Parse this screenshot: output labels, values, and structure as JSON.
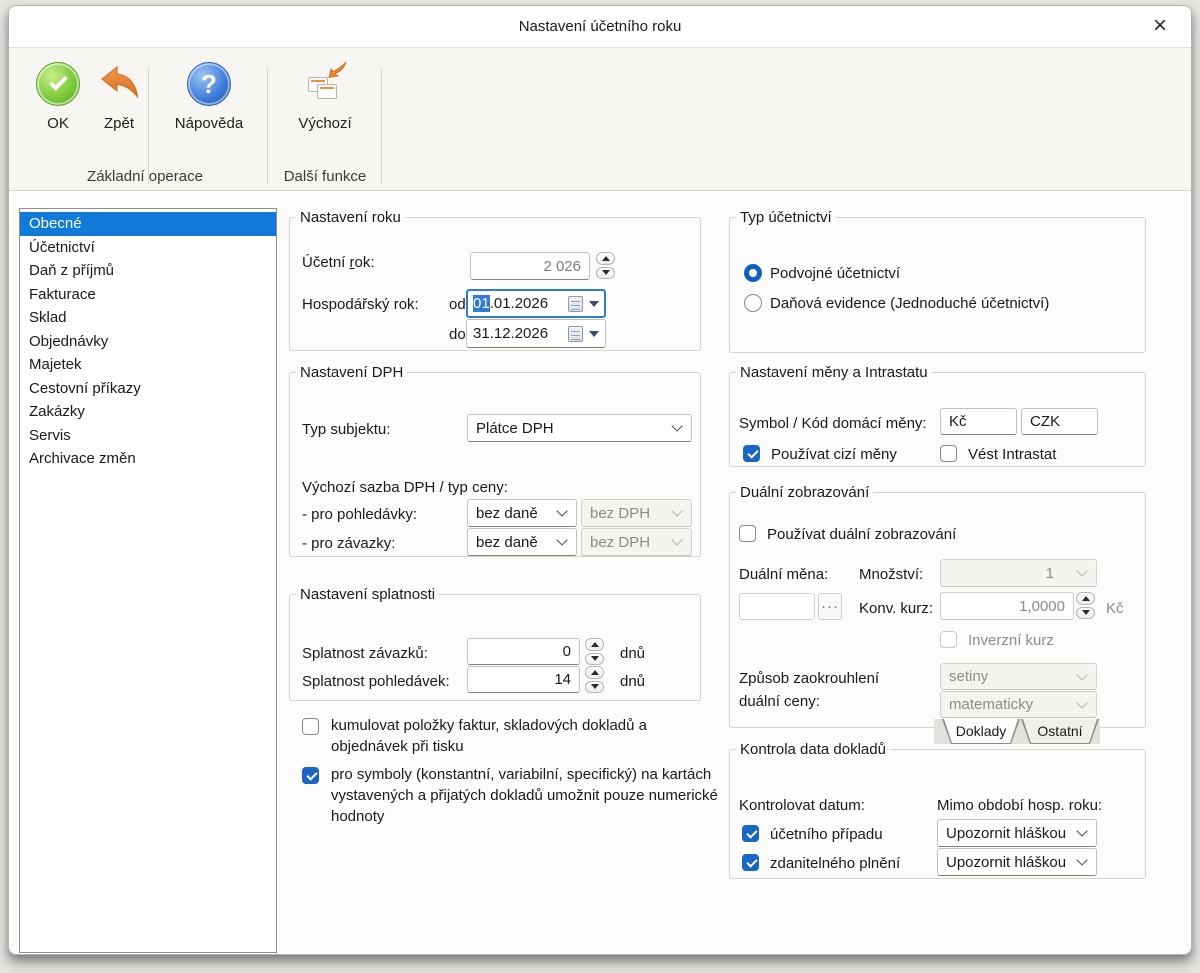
{
  "window": {
    "title": "Nastavení účetního roku",
    "close": "×"
  },
  "colors": {
    "accent": "#0f7ad8",
    "control_blue": "#1a66c4",
    "ok_green": "#6fc32f",
    "undo_orange": "#e0772b"
  },
  "icons": {
    "ok": "green-circle-check",
    "zpet": "orange-undo-arrow",
    "napoveda": "blue-circle-question",
    "vychozi": "windows-with-arrow",
    "date": "calendar-grid"
  },
  "toolbar": {
    "ok": "OK",
    "zpet": "Zpět",
    "napoveda": "Nápověda",
    "vychozi": "Výchozí",
    "group_basic": "Základní operace",
    "group_other": "Další funkce"
  },
  "sidebar": {
    "items": [
      "Obecné",
      "Účetnictví",
      "Daň z příjmů",
      "Fakturace",
      "Sklad",
      "Objednávky",
      "Majetek",
      "Cestovní příkazy",
      "Zakázky",
      "Servis",
      "Archivace změn"
    ],
    "selected": "Obecné"
  },
  "year": {
    "legend": "Nastavení roku",
    "ucetni_pre": "Účetní ",
    "ucetni_key": "r",
    "ucetni_post": "ok:",
    "ucetni_value": "2 026",
    "hosp_label": "Hospodářský rok:",
    "od_label": "od",
    "do_label": "do",
    "od_selected": "01",
    "od_rest": ".01.2026",
    "do_value": "31.12.2026"
  },
  "dph": {
    "legend": "Nastavení DPH",
    "typ_label": "Typ subjektu:",
    "typ_value": "Plátce DPH",
    "sazba_label": "Výchozí sazba DPH / typ ceny:",
    "rows": [
      {
        "label": "- pro pohledávky:",
        "sazba": "bez daně",
        "cena": "bez DPH"
      },
      {
        "label": "- pro závazky:",
        "sazba": "bez daně",
        "cena": "bez DPH"
      }
    ]
  },
  "splatnost": {
    "legend": "Nastavení splatnosti",
    "rows": [
      {
        "label": "Splatnost závazků:",
        "value": "0",
        "unit": "dnů"
      },
      {
        "label": "Splatnost pohledávek:",
        "value": "14",
        "unit": "dnů"
      }
    ]
  },
  "options": {
    "kumulovat": "kumulovat položky faktur, skladových dokladů a objednávek při tisku",
    "symboly": "pro symboly (konstantní, variabilní, specifický) na kartách vystavených a přijatých dokladů umožnit pouze numerické hodnoty"
  },
  "typ_uctu": {
    "legend": "Typ účetnictví",
    "podvojne": "Podvojné účetnictví",
    "danova": "Daňová evidence (Jednoduché účetnictví)"
  },
  "mena": {
    "legend": "Nastavení měny a Intrastatu",
    "symbol_label": "Symbol / Kód domácí měny:",
    "symbol": "Kč",
    "kod": "CZK",
    "cizi_meny": "Používat cizí měny",
    "intrastat": "Vést Intrastat"
  },
  "dual": {
    "legend": "Duální zobrazování",
    "pouzivat": "Používat duální zobrazování",
    "mena_label": "Duální měna:",
    "mena_value": "",
    "dots": "···",
    "mnozstvi_label": "Množství:",
    "mnozstvi_value": "1",
    "kurz_label": "Konv. kurz:",
    "kurz_value": "1,0000",
    "kurz_unit": "Kč",
    "inverzni": "Inverzní kurz",
    "zpusob_line1": "Způsob zaokrouhlení",
    "zpusob_line2": "duální ceny:",
    "zaokrouhleni": "setiny",
    "metoda": "matematicky",
    "tabs": [
      "Doklady",
      "Ostatní"
    ]
  },
  "kontrola": {
    "legend": "Kontrola data dokladů",
    "datum_label": "Kontrolovat datum:",
    "mimo_label": "Mimo období hosp. roku:",
    "rows": [
      {
        "label": "účetního případu",
        "value": "Upozornit hláškou"
      },
      {
        "label": "zdanitelného plnění",
        "value": "Upozornit hláškou"
      }
    ]
  }
}
